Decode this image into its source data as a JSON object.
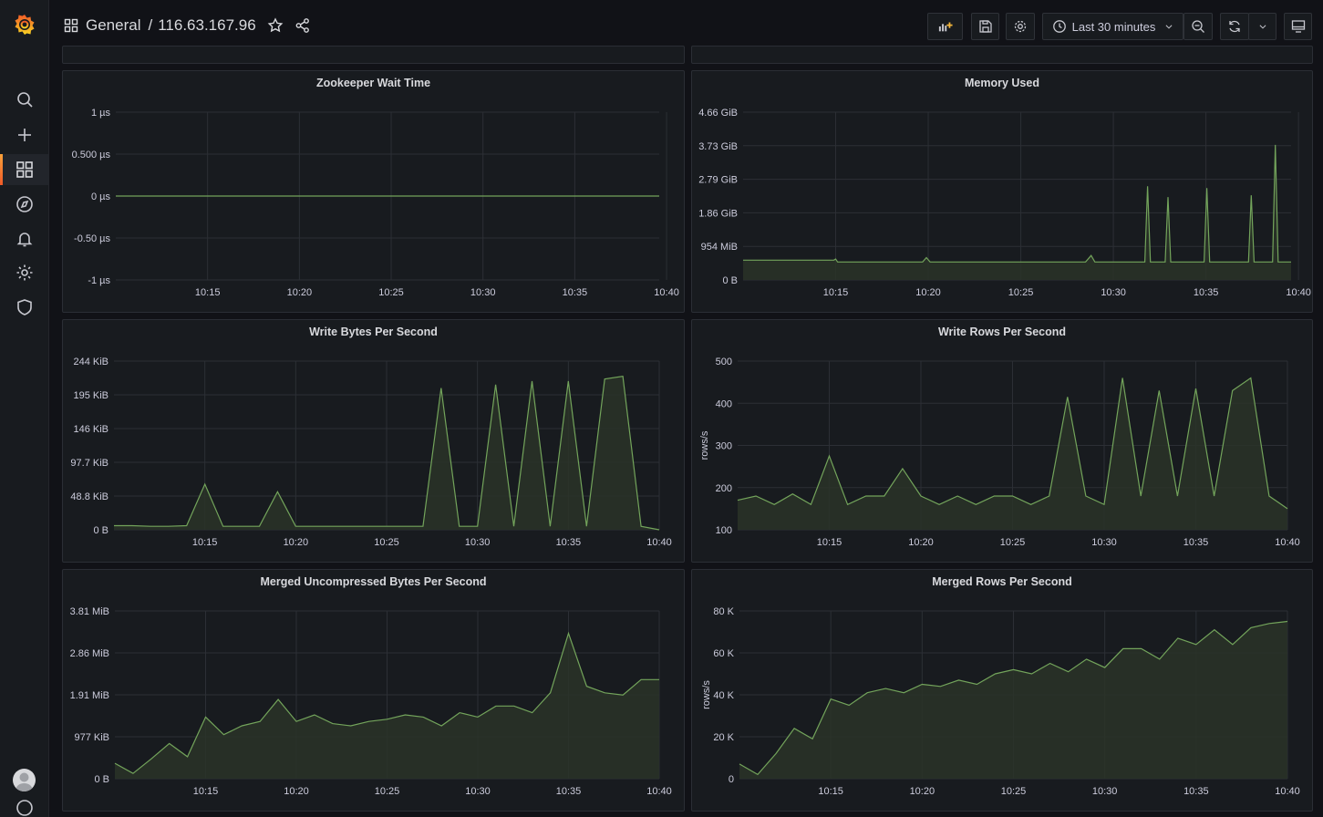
{
  "header": {
    "folder": "General",
    "separator": "/",
    "title": "116.63.167.96",
    "time_range": "Last 30 minutes"
  },
  "colors": {
    "series": "#73a45b",
    "fill": "#2a3228",
    "grid": "#2c2f35",
    "accent": "#f05a28"
  },
  "sidebar": {
    "items": [
      {
        "name": "search-icon"
      },
      {
        "name": "plus-icon"
      },
      {
        "name": "dashboards-icon"
      },
      {
        "name": "explore-icon"
      },
      {
        "name": "alerting-icon"
      },
      {
        "name": "configuration-icon"
      },
      {
        "name": "shield-icon"
      }
    ]
  },
  "chart_data": [
    {
      "type": "line",
      "title": "Zookeeper Wait Time",
      "ylabel": "",
      "y_ticks": [
        "1 µs",
        "0.500 µs",
        "0 µs",
        "-0.50 µs",
        "-1 µs"
      ],
      "x_ticks": [
        "10:15",
        "10:20",
        "10:25",
        "10:30",
        "10:35",
        "10:40"
      ],
      "ylim": [
        -1,
        1
      ],
      "series": [
        {
          "x": [
            0,
            29.6
          ],
          "values": [
            0,
            0
          ]
        }
      ]
    },
    {
      "type": "area",
      "title": "Memory Used",
      "ylabel": "",
      "y_ticks": [
        "4.66 GiB",
        "3.73 GiB",
        "2.79 GiB",
        "1.86 GiB",
        "954 MiB",
        "0 B"
      ],
      "x_ticks": [
        "10:15",
        "10:20",
        "10:25",
        "10:30",
        "10:35",
        "10:40"
      ],
      "ylim": [
        0,
        4.66
      ],
      "series": [
        {
          "x": [
            0,
            4.9,
            5.0,
            5.1,
            9.7,
            9.9,
            10.1,
            18.5,
            18.8,
            19.0,
            21.7,
            21.85,
            22.0,
            22.8,
            22.95,
            23.1,
            24.9,
            25.05,
            25.2,
            27.3,
            27.45,
            27.6,
            28.6,
            28.75,
            28.9,
            29.6
          ],
          "values": [
            0.55,
            0.55,
            0.58,
            0.5,
            0.5,
            0.62,
            0.5,
            0.5,
            0.68,
            0.5,
            0.5,
            2.6,
            0.5,
            0.5,
            2.3,
            0.5,
            0.5,
            2.55,
            0.5,
            0.5,
            2.35,
            0.5,
            0.5,
            3.75,
            0.5,
            0.5
          ]
        }
      ]
    },
    {
      "type": "area",
      "title": "Write Bytes Per Second",
      "ylabel": "",
      "y_ticks": [
        "244 KiB",
        "195 KiB",
        "146 KiB",
        "97.7 KiB",
        "48.8 KiB",
        "0 B"
      ],
      "x_ticks": [
        "10:15",
        "10:20",
        "10:25",
        "10:30",
        "10:35",
        "10:40"
      ],
      "ylim": [
        0,
        244
      ],
      "series": [
        {
          "x": [
            0,
            1,
            2,
            3,
            4,
            5,
            6,
            7,
            8,
            9,
            10,
            11,
            12,
            13,
            14,
            15,
            16,
            17,
            18,
            19,
            20,
            21,
            22,
            23,
            24,
            25,
            26,
            27,
            28,
            29,
            30
          ],
          "values": [
            6,
            6,
            5,
            5,
            6,
            66,
            5,
            5,
            5,
            55,
            5,
            5,
            5,
            5,
            5,
            5,
            5,
            5,
            205,
            5,
            5,
            210,
            5,
            215,
            5,
            215,
            5,
            218,
            222,
            5,
            0
          ]
        }
      ]
    },
    {
      "type": "area",
      "title": "Write Rows Per Second",
      "ylabel": "rows/s",
      "y_ticks": [
        "500",
        "400",
        "300",
        "200",
        "100"
      ],
      "x_ticks": [
        "10:15",
        "10:20",
        "10:25",
        "10:30",
        "10:35",
        "10:40"
      ],
      "ylim": [
        100,
        500
      ],
      "series": [
        {
          "x": [
            0,
            1,
            2,
            3,
            4,
            5,
            6,
            7,
            8,
            9,
            10,
            11,
            12,
            13,
            14,
            15,
            16,
            17,
            18,
            19,
            20,
            21,
            22,
            23,
            24,
            25,
            26,
            27,
            28,
            29,
            30
          ],
          "values": [
            170,
            180,
            160,
            185,
            160,
            275,
            160,
            180,
            180,
            245,
            180,
            160,
            180,
            160,
            180,
            180,
            160,
            180,
            415,
            180,
            160,
            460,
            180,
            430,
            180,
            435,
            180,
            430,
            460,
            180,
            150
          ]
        }
      ]
    },
    {
      "type": "area",
      "title": "Merged Uncompressed Bytes Per Second",
      "ylabel": "",
      "y_ticks": [
        "3.81 MiB",
        "2.86 MiB",
        "1.91 MiB",
        "977 KiB",
        "0 B"
      ],
      "x_ticks": [
        "10:15",
        "10:20",
        "10:25",
        "10:30",
        "10:35",
        "10:40"
      ],
      "ylim": [
        0,
        3.81
      ],
      "series": [
        {
          "x": [
            0,
            1,
            2,
            3,
            4,
            5,
            6,
            7,
            8,
            9,
            10,
            11,
            12,
            13,
            14,
            15,
            16,
            17,
            18,
            19,
            20,
            21,
            22,
            23,
            24,
            25,
            26,
            27,
            28,
            29,
            30
          ],
          "values": [
            0.35,
            0.12,
            0.45,
            0.8,
            0.5,
            1.4,
            1.0,
            1.2,
            1.3,
            1.8,
            1.3,
            1.45,
            1.25,
            1.2,
            1.3,
            1.35,
            1.45,
            1.4,
            1.2,
            1.5,
            1.4,
            1.65,
            1.65,
            1.5,
            1.95,
            3.3,
            2.1,
            1.95,
            1.9,
            2.25,
            2.25
          ]
        }
      ]
    },
    {
      "type": "area",
      "title": "Merged Rows Per Second",
      "ylabel": "rows/s",
      "y_ticks": [
        "80 K",
        "60 K",
        "40 K",
        "20 K",
        "0"
      ],
      "x_ticks": [
        "10:15",
        "10:20",
        "10:25",
        "10:30",
        "10:35",
        "10:40"
      ],
      "ylim": [
        0,
        80
      ],
      "series": [
        {
          "x": [
            0,
            1,
            2,
            3,
            4,
            5,
            6,
            7,
            8,
            9,
            10,
            11,
            12,
            13,
            14,
            15,
            16,
            17,
            18,
            19,
            20,
            21,
            22,
            23,
            24,
            25,
            26,
            27,
            28,
            29,
            30
          ],
          "values": [
            7,
            2,
            12,
            24,
            19,
            38,
            35,
            41,
            43,
            41,
            45,
            44,
            47,
            45,
            50,
            52,
            50,
            55,
            51,
            57,
            53,
            62,
            62,
            57,
            67,
            64,
            71,
            64,
            72,
            74,
            75
          ]
        }
      ]
    }
  ]
}
